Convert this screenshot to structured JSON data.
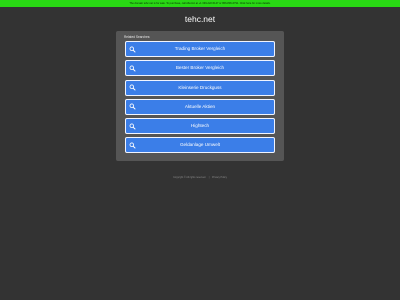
{
  "banner": {
    "text": "The domain tehc.net is for sale. To purchase, call Afternic at +1 339-222-5147 or 866-836-6791. Click here for more details."
  },
  "site": {
    "title": "tehc.net"
  },
  "panel": {
    "heading": "Related Searches:",
    "links": [
      {
        "label": "Trading Broker Vergleich",
        "icon": "search-icon"
      },
      {
        "label": "Bester Broker Vergleich",
        "icon": "search-icon"
      },
      {
        "label": "Kleinserie Druckguss",
        "icon": "search-icon"
      },
      {
        "label": "Aktuelle Aktien",
        "icon": "search-icon"
      },
      {
        "label": "Hightech",
        "icon": "search-icon"
      },
      {
        "label": "Geldanlage Umwelt",
        "icon": "search-icon"
      }
    ]
  },
  "footer": {
    "copyright": "Copyright © All rights reserved.",
    "separator": "|",
    "privacy": "Privacy Policy"
  },
  "colors": {
    "background": "#333333",
    "banner": "#29d814",
    "panel": "#555555",
    "button": "#3b7ee8"
  }
}
